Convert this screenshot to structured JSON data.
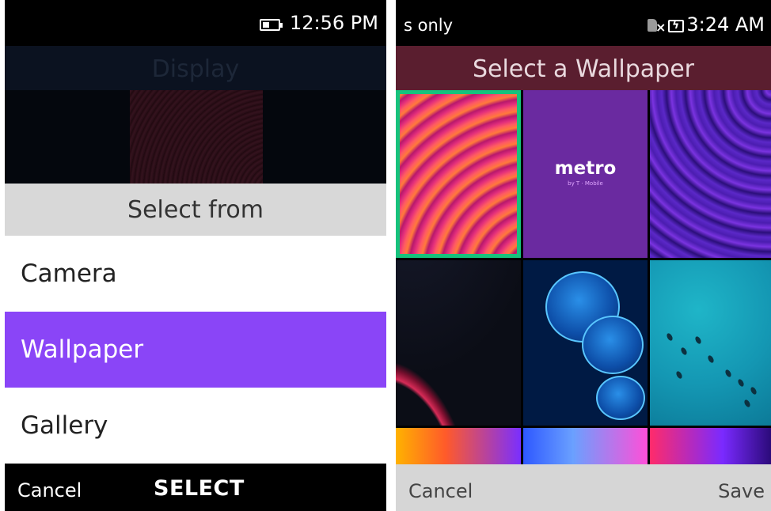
{
  "left_screen": {
    "status_bar": {
      "time": "12:56 PM",
      "battery_icon": "battery-icon"
    },
    "background_title": "Display",
    "sheet_title": "Select from",
    "options": [
      {
        "label": "Camera",
        "selected": false
      },
      {
        "label": "Wallpaper",
        "selected": true
      },
      {
        "label": "Gallery",
        "selected": false
      }
    ],
    "softkeys": {
      "left": "Cancel",
      "center": "SELECT"
    },
    "colors": {
      "selection": "#8a45f7"
    }
  },
  "right_screen": {
    "status_bar": {
      "left_text": "s only",
      "time": "3:24 AM",
      "icons": [
        "no-sim-icon",
        "battery-charging-icon"
      ]
    },
    "title": "Select a Wallpaper",
    "wallpapers": {
      "metro_logo": "metro",
      "metro_tagline": "by T · Mobile",
      "selected_index": 0,
      "count_visible": 9
    },
    "softkeys": {
      "left": "Cancel",
      "right": "Save"
    },
    "colors": {
      "header": "#5a1e2f",
      "selection_frame": "#16c27c"
    }
  }
}
